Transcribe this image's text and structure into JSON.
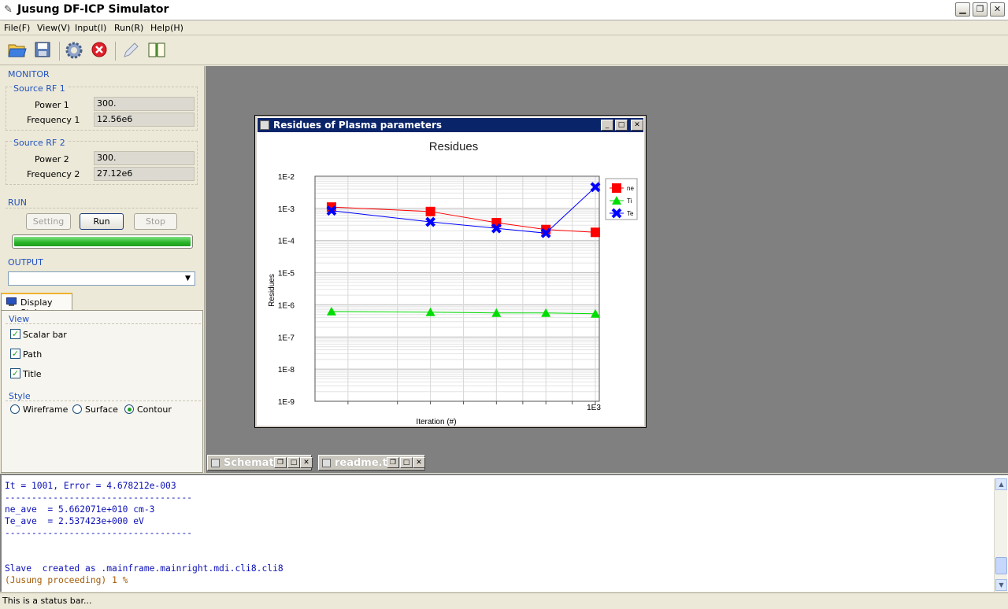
{
  "window": {
    "title": "Jusung DF-ICP Simulator"
  },
  "menu": [
    "File(F)",
    "View(V)",
    "Input(I)",
    "Run(R)",
    "Help(H)"
  ],
  "monitor": {
    "heading": "MONITOR",
    "rf1": {
      "label": "Source RF 1",
      "power_label": "Power 1",
      "power_value": "300.",
      "freq_label": "Frequency 1",
      "freq_value": "12.56e6"
    },
    "rf2": {
      "label": "Source RF 2",
      "power_label": "Power 2",
      "power_value": "300.",
      "freq_label": "Frequency 2",
      "freq_value": "27.12e6"
    }
  },
  "run": {
    "heading": "RUN",
    "setting": "Setting",
    "run": "Run",
    "stop": "Stop",
    "progress": 1.0
  },
  "output": {
    "heading": "OUTPUT",
    "selected": ""
  },
  "display": {
    "tab": "Display Style",
    "view_heading": "View",
    "scalar_bar": "Scalar bar",
    "path": "Path",
    "title": "Title",
    "style_heading": "Style",
    "wireframe": "Wireframe",
    "surface": "Surface",
    "contour": "Contour",
    "selected_style": "Contour"
  },
  "subwindow": {
    "title": "Residues of Plasma parameters"
  },
  "minimized": [
    "Schemat",
    "readme.t"
  ],
  "chart_data": {
    "type": "line",
    "title": "Residues",
    "xlabel": "Iteration (#)",
    "ylabel": "Residues",
    "x_tick_label": "1E3",
    "y_scale": "log",
    "ylim": [
      1e-09,
      0.01
    ],
    "y_ticks": [
      "1E-2",
      "1E-3",
      "1E-4",
      "1E-5",
      "1E-6",
      "1E-7",
      "1E-8",
      "1E-9"
    ],
    "grid": true,
    "legend": "top-right",
    "x": [
      200,
      500,
      700,
      850,
      1000
    ],
    "series": [
      {
        "name": "ne",
        "color": "#ff0000",
        "marker": "square",
        "values": [
          0.0011,
          0.0008,
          0.00036,
          0.00022,
          0.00018
        ]
      },
      {
        "name": "Ti",
        "color": "#00dd00",
        "marker": "triangle",
        "values": [
          6.2e-07,
          5.9e-07,
          5.6e-07,
          5.6e-07,
          5.3e-07
        ]
      },
      {
        "name": "Te",
        "color": "#0000ff",
        "marker": "x",
        "values": [
          0.00085,
          0.00038,
          0.00024,
          0.00017,
          0.0046
        ]
      }
    ]
  },
  "console": {
    "lines": [
      "It = 1001, Error = 4.678212e-003",
      "-----------------------------------",
      "ne_ave  = 5.662071e+010 cm-3",
      "Te_ave  = 2.537423e+000 eV",
      "-----------------------------------",
      "",
      "",
      "Slave  created as .mainframe.mainright.mdi.cli8.cli8"
    ],
    "last_line": "(Jusung proceeding) 1 %"
  },
  "status": "This is a status bar..."
}
